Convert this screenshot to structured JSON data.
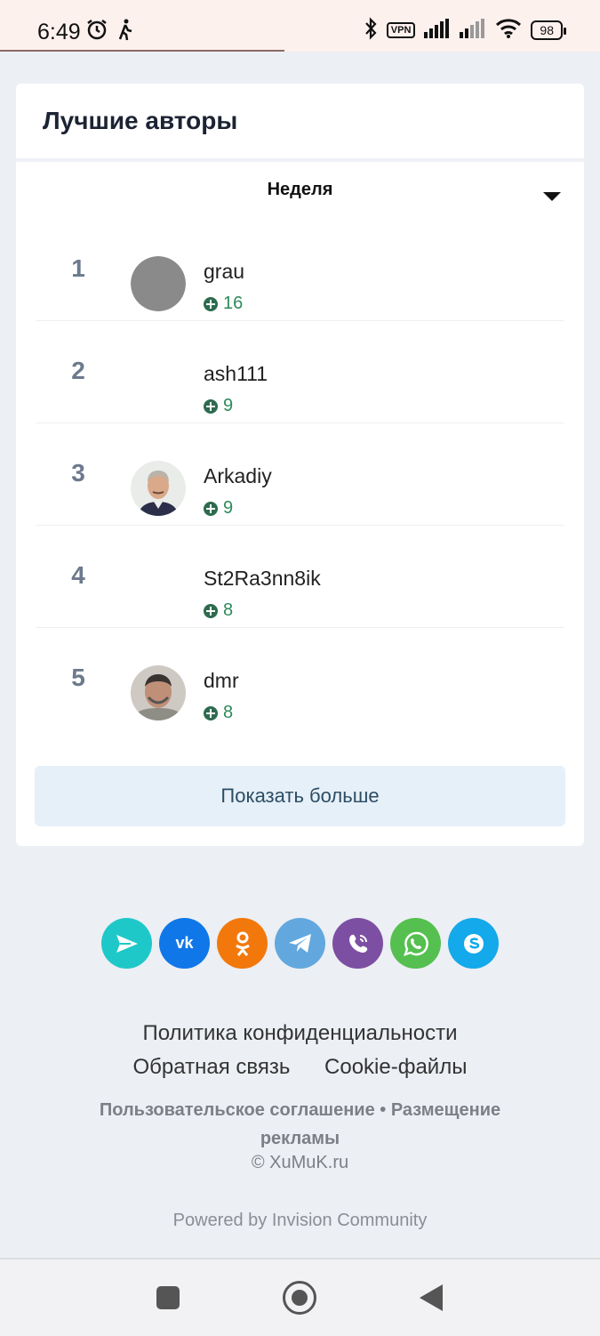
{
  "status_bar": {
    "time": "6:49",
    "vpn": "VPN",
    "battery": "98",
    "icons": [
      "alarm-icon",
      "walking-icon",
      "bluetooth-icon",
      "vpn-icon",
      "signal-icon",
      "signal-icon",
      "wifi-icon",
      "battery-icon"
    ]
  },
  "card": {
    "title": "Лучшие авторы",
    "filter_label": "Неделя",
    "show_more": "Показать больше"
  },
  "authors": [
    {
      "rank": "1",
      "name": "grau",
      "score": "16",
      "avatar": "gray-circle"
    },
    {
      "rank": "2",
      "name": "ash111",
      "score": "9",
      "avatar": "none"
    },
    {
      "rank": "3",
      "name": "Arkadiy",
      "score": "9",
      "avatar": "photo"
    },
    {
      "rank": "4",
      "name": "St2Ra3nn8ik",
      "score": "8",
      "avatar": "none"
    },
    {
      "rank": "5",
      "name": "dmr",
      "score": "8",
      "avatar": "photo"
    }
  ],
  "social": [
    {
      "name": "share-icon",
      "color": "#1fc8c8"
    },
    {
      "name": "vk-icon",
      "color": "#0f77e8",
      "glyph": "vk"
    },
    {
      "name": "odnoklassniki-icon",
      "color": "#f2780c"
    },
    {
      "name": "telegram-icon",
      "color": "#62a8de"
    },
    {
      "name": "viber-icon",
      "color": "#7d4fa2"
    },
    {
      "name": "whatsapp-icon",
      "color": "#55c04f"
    },
    {
      "name": "skype-icon",
      "color": "#13a9ea"
    }
  ],
  "footer": {
    "privacy": "Политика конфиденциальности",
    "feedback": "Обратная связь",
    "cookies": "Cookie-файлы",
    "agreement": "Пользовательское соглашение • Размещение рекламы",
    "copyright": "© XuMuK.ru",
    "powered": "Powered by Invision Community"
  }
}
